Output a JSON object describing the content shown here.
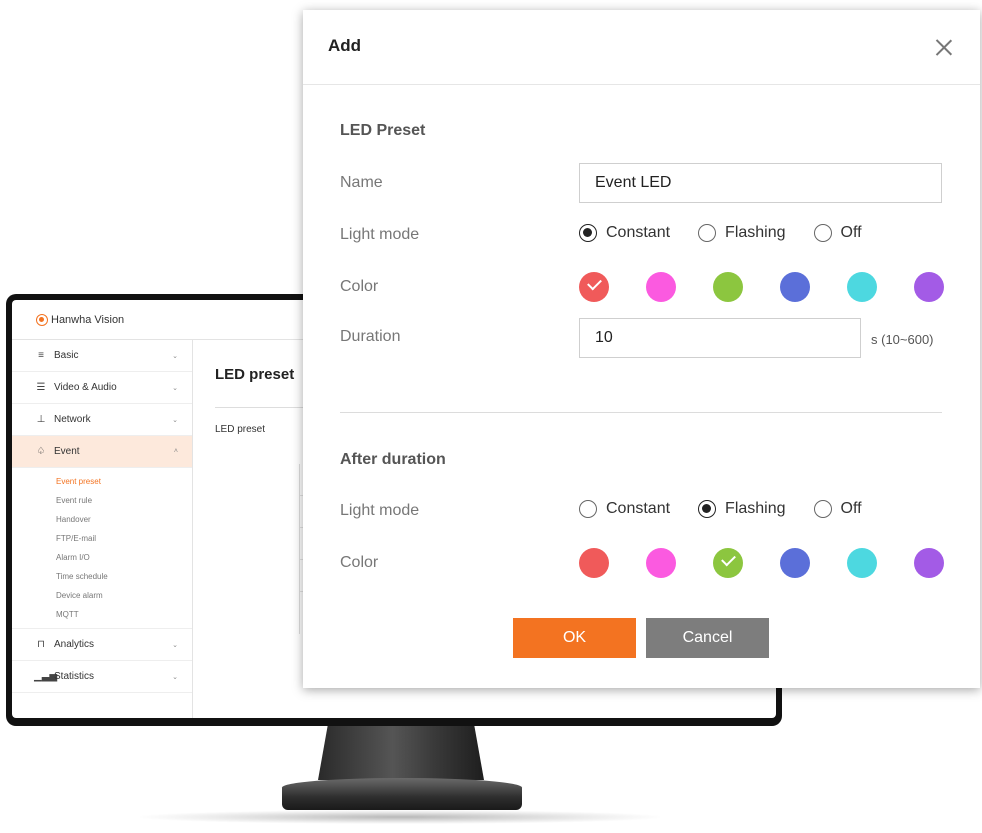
{
  "monitor_app": {
    "brand": "Hanwha Vision",
    "sidebar": [
      {
        "icon": "list-icon",
        "label": "Basic"
      },
      {
        "icon": "sliders-icon",
        "label": "Video & Audio"
      },
      {
        "icon": "network-icon",
        "label": "Network"
      },
      {
        "icon": "bell-icon",
        "label": "Event"
      },
      {
        "icon": "analytics-icon",
        "label": "Analytics"
      },
      {
        "icon": "bar-chart-icon",
        "label": "Statistics"
      }
    ],
    "event_subitems": [
      "Event preset",
      "Event rule",
      "Handover",
      "FTP/E-mail",
      "Alarm I/O",
      "Time schedule",
      "Device alarm",
      "MQTT"
    ],
    "active_subitem": "Event preset",
    "content_title": "LED preset",
    "content_label": "LED preset"
  },
  "dialog": {
    "title": "Add",
    "led_preset": {
      "section_title": "LED Preset",
      "name_label": "Name",
      "name_value": "Event LED",
      "light_mode_label": "Light mode",
      "light_mode_options": [
        "Constant",
        "Flashing",
        "Off"
      ],
      "light_mode_selected": "Constant",
      "color_label": "Color",
      "duration_label": "Duration",
      "duration_value": "10",
      "duration_unit": "s (10~600)",
      "selected_color": "#f05a5a"
    },
    "after_duration": {
      "section_title": "After duration",
      "light_mode_label": "Light mode",
      "light_mode_options": [
        "Constant",
        "Flashing",
        "Off"
      ],
      "light_mode_selected": "Flashing",
      "color_label": "Color",
      "selected_color": "#8cc63f"
    },
    "colors": [
      "#f05a5a",
      "#fb5ae0",
      "#8cc63f",
      "#5b6fd9",
      "#4dd8e0",
      "#a35be6"
    ],
    "ok_label": "OK",
    "cancel_label": "Cancel"
  }
}
